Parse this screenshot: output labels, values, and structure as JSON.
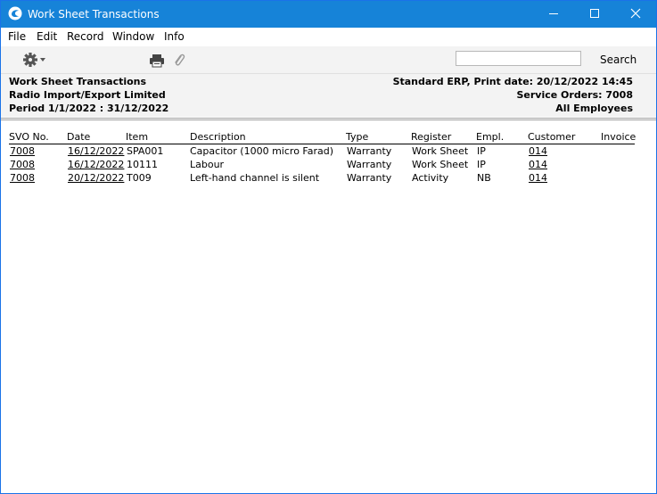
{
  "window": {
    "title": "Work Sheet Transactions"
  },
  "menu": {
    "items": [
      "File",
      "Edit",
      "Record",
      "Window",
      "Info"
    ]
  },
  "toolbar": {
    "search_value": "",
    "search_label": "Search"
  },
  "report_header": {
    "left": {
      "title": "Work Sheet Transactions",
      "company": "Radio Import/Export Limited",
      "period": "Period  1/1/2022 : 31/12/2022"
    },
    "right": {
      "print_info": "Standard ERP, Print date: 20/12/2022 14:45",
      "service_orders": "Service Orders: 7008",
      "employees": "All Employees"
    }
  },
  "table": {
    "columns": [
      "SVO No.",
      "Date",
      "Item",
      "Description",
      "Type",
      "Register",
      "Empl.",
      "Customer",
      "Invoice"
    ],
    "rows": [
      {
        "svo": "7008",
        "date": "16/12/2022",
        "item": "SPA001",
        "description": "Capacitor (1000 micro Farad)",
        "type": "Warranty",
        "register": "Work Sheet",
        "empl": "IP",
        "customer": "014",
        "invoice": ""
      },
      {
        "svo": "7008",
        "date": "16/12/2022",
        "item": "10111",
        "description": "Labour",
        "type": "Warranty",
        "register": "Work Sheet",
        "empl": "IP",
        "customer": "014",
        "invoice": ""
      },
      {
        "svo": "7008",
        "date": "20/12/2022",
        "item": "T009",
        "description": "Left-hand channel is silent",
        "type": "Warranty",
        "register": "Activity",
        "empl": "NB",
        "customer": "014",
        "invoice": ""
      }
    ]
  },
  "icons": {
    "app": "app-logo-icon",
    "settings": "gear-icon",
    "print": "printer-icon",
    "attach": "paperclip-icon",
    "minimize": "minimize-icon",
    "maximize": "maximize-icon",
    "close": "close-icon"
  },
  "colors": {
    "titlebar": "#1683d8",
    "toolbar_bg": "#f3f3f3"
  }
}
